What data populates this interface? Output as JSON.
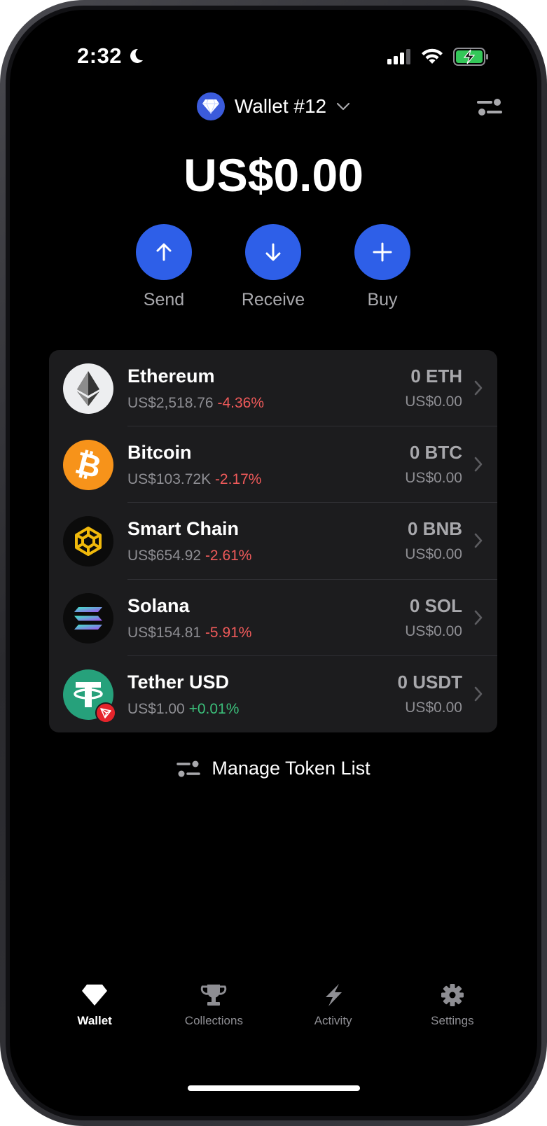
{
  "status": {
    "time": "2:32"
  },
  "header": {
    "wallet_name": "Wallet #12"
  },
  "balance": "US$0.00",
  "actions": [
    {
      "label": "Send",
      "icon": "arrow-up-icon"
    },
    {
      "label": "Receive",
      "icon": "arrow-down-icon"
    },
    {
      "label": "Buy",
      "icon": "plus-icon"
    }
  ],
  "tokens": [
    {
      "name": "Ethereum",
      "price": "US$2,518.76",
      "change": "-4.36%",
      "amount": "0 ETH",
      "value": "US$0.00"
    },
    {
      "name": "Bitcoin",
      "price": "US$103.72K",
      "change": "-2.17%",
      "amount": "0 BTC",
      "value": "US$0.00"
    },
    {
      "name": "Smart Chain",
      "price": "US$654.92",
      "change": "-2.61%",
      "amount": "0 BNB",
      "value": "US$0.00"
    },
    {
      "name": "Solana",
      "price": "US$154.81",
      "change": "-5.91%",
      "amount": "0 SOL",
      "value": "US$0.00"
    },
    {
      "name": "Tether USD",
      "price": "US$1.00",
      "change": "+0.01%",
      "amount": "0 USDT",
      "value": "US$0.00"
    }
  ],
  "manage_label": "Manage Token List",
  "tabs": [
    {
      "label": "Wallet",
      "active": true
    },
    {
      "label": "Collections",
      "active": false
    },
    {
      "label": "Activity",
      "active": false
    },
    {
      "label": "Settings",
      "active": false
    }
  ],
  "colors": {
    "accent": "#2e5fe8",
    "negative": "#ef5a5a",
    "positive": "#3bbf7a",
    "card": "#1c1c1e"
  }
}
